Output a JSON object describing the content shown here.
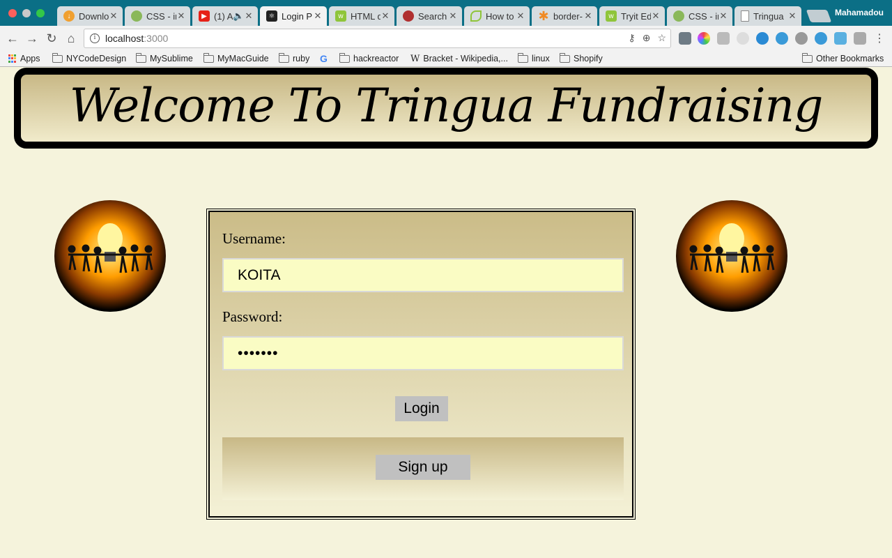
{
  "browser": {
    "profile_name": "Mahamadou",
    "tabs": [
      {
        "label": "Downlo",
        "icon": "download-icon",
        "color": "#f0a030"
      },
      {
        "label": "CSS - ir",
        "icon": "android-icon",
        "color": "#8ab85a"
      },
      {
        "label": "(1) A",
        "icon": "youtube-icon",
        "color": "#e62117"
      },
      {
        "label": "Login P",
        "icon": "react-icon",
        "color": "#222222",
        "active": true
      },
      {
        "label": "HTML d",
        "icon": "w3schools-icon",
        "color": "#8fc53a"
      },
      {
        "label": "Search",
        "icon": "ninja-icon",
        "color": "#b03030"
      },
      {
        "label": "How to",
        "icon": "leaf-icon",
        "color": "#8fc53a"
      },
      {
        "label": "border-",
        "icon": "asterisk-icon",
        "color": "#f08a24"
      },
      {
        "label": "Tryit Ed",
        "icon": "w3schools-icon",
        "color": "#8fc53a"
      },
      {
        "label": "CSS - ir",
        "icon": "android-icon",
        "color": "#8ab85a"
      },
      {
        "label": "Tringua",
        "icon": "page-icon",
        "color": "#888888"
      }
    ],
    "url_host": "localhost",
    "url_port": ":3000",
    "bookmarks": [
      {
        "label": "Apps",
        "icon": "apps-grid-icon"
      },
      {
        "label": "NYCodeDesign",
        "icon": "folder-icon"
      },
      {
        "label": "MySublime",
        "icon": "folder-icon"
      },
      {
        "label": "MyMacGuide",
        "icon": "folder-icon"
      },
      {
        "label": "ruby",
        "icon": "folder-icon"
      },
      {
        "label": "",
        "icon": "google-icon"
      },
      {
        "label": "hackreactor",
        "icon": "folder-icon"
      },
      {
        "label": "Bracket - Wikipedia,...",
        "icon": "wikipedia-icon"
      },
      {
        "label": "linux",
        "icon": "folder-icon"
      },
      {
        "label": "Shopify",
        "icon": "folder-icon"
      }
    ],
    "other_bookmarks": "Other Bookmarks"
  },
  "page": {
    "title": "Welcome To Tringua Fundraising",
    "username_label": "Username:",
    "username_value": "KOITA",
    "password_label": "Password:",
    "password_value": "•••••••",
    "login_label": "Login",
    "signup_label": "Sign up"
  }
}
